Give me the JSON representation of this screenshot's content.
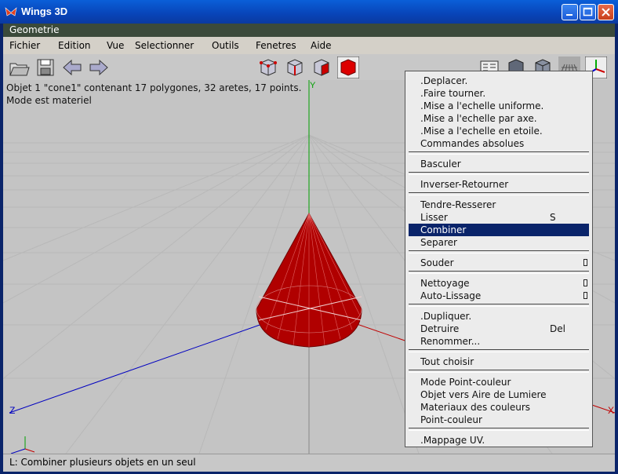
{
  "window": {
    "title": "Wings 3D",
    "subtitle": "Geometrie"
  },
  "menubar": [
    "Fichier",
    "Edition",
    "Vue",
    "Selectionner",
    "Outils",
    "Fenetres",
    "Aide"
  ],
  "info": {
    "line1": "Objet 1 \"cone1\" contenant 17 polygones, 32 aretes, 17 points.",
    "line2": "Mode est materiel"
  },
  "axes": {
    "y": "Y",
    "z": "Z",
    "x": "X"
  },
  "status": "L: Combiner plusieurs objets en un seul",
  "context_menu": {
    "items": [
      {
        "label": ".Deplacer."
      },
      {
        "label": ".Faire tourner."
      },
      {
        "label": ".Mise a l'echelle uniforme."
      },
      {
        "label": ".Mise a l'echelle par axe."
      },
      {
        "label": ".Mise a l'echelle en etoile."
      },
      {
        "label": "Commandes absolues"
      },
      {
        "label": "Basculer"
      },
      {
        "label": "Inverser-Retourner"
      },
      {
        "label": "Tendre-Resserer"
      },
      {
        "label": "Lisser",
        "shortcut": "S"
      },
      {
        "label": "Combiner",
        "highlighted": true
      },
      {
        "label": "Separer"
      },
      {
        "label": "Souder"
      },
      {
        "label": "Nettoyage"
      },
      {
        "label": "Auto-Lissage"
      },
      {
        "label": ".Dupliquer."
      },
      {
        "label": "Detruire",
        "shortcut": "Del"
      },
      {
        "label": "Renommer..."
      },
      {
        "label": "Tout choisir"
      },
      {
        "label": "Mode Point-couleur"
      },
      {
        "label": "Objet vers Aire de Lumiere"
      },
      {
        "label": "Materiaux des couleurs"
      },
      {
        "label": "Point-couleur"
      },
      {
        "label": ".Mappage UV."
      }
    ]
  },
  "colors": {
    "cone": "#b00000",
    "highlight": "#0a246a",
    "viewport": "#c4c4c4",
    "axis_x": "#c00000",
    "axis_y": "#00a000",
    "axis_z": "#0000c0"
  },
  "toolbar_icons": [
    "open-icon",
    "save-icon",
    "undo-arrow-icon",
    "redo-arrow-icon",
    "vertex-mode-icon",
    "edge-mode-icon",
    "face-mode-icon",
    "body-mode-icon",
    "info-icon",
    "smooth-icon",
    "flat-icon",
    "groundplane-icon",
    "axes-icon"
  ]
}
